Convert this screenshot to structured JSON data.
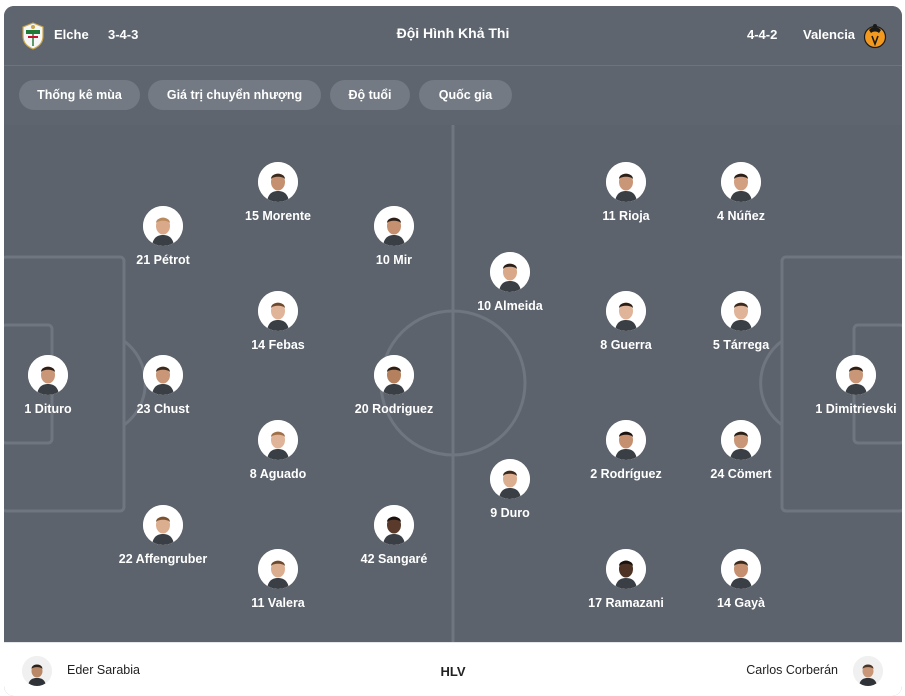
{
  "header": {
    "title": "Đội Hình Khả Thi",
    "home": {
      "name": "Elche",
      "formation": "3-4-3",
      "badge_icon": "elche-badge-icon"
    },
    "away": {
      "name": "Valencia",
      "formation": "4-4-2",
      "badge_icon": "valencia-badge-icon"
    }
  },
  "filters": [
    {
      "label": "Thống kê mùa"
    },
    {
      "label": "Giá trị chuyển nhượng"
    },
    {
      "label": "Độ tuổi"
    },
    {
      "label": "Quốc gia"
    }
  ],
  "players": {
    "home": [
      {
        "label": "1 Dituro"
      },
      {
        "label": "21 Pétrot"
      },
      {
        "label": "23 Chust"
      },
      {
        "label": "22 Affengruber"
      },
      {
        "label": "15 Morente"
      },
      {
        "label": "14 Febas"
      },
      {
        "label": "8 Aguado"
      },
      {
        "label": "11 Valera"
      },
      {
        "label": "10 Mir"
      },
      {
        "label": "20 Rodriguez"
      },
      {
        "label": "42 Sangaré"
      }
    ],
    "away": [
      {
        "label": "1 Dimitrievski"
      },
      {
        "label": "4 Núñez"
      },
      {
        "label": "5 Tárrega"
      },
      {
        "label": "24 Cömert"
      },
      {
        "label": "14 Gayà"
      },
      {
        "label": "11 Rioja"
      },
      {
        "label": "8 Guerra"
      },
      {
        "label": "2 Rodríguez"
      },
      {
        "label": "17 Ramazani"
      },
      {
        "label": "10 Almeida"
      },
      {
        "label": "9 Duro"
      }
    ]
  },
  "footer": {
    "home_coach": "Eder Sarabia",
    "center_label": "HLV",
    "away_coach": "Carlos Corberán"
  },
  "colors": {
    "pitch": "#5c636c",
    "chip": "#737a83",
    "lines": "#6f767f",
    "text": "#ffffff"
  }
}
